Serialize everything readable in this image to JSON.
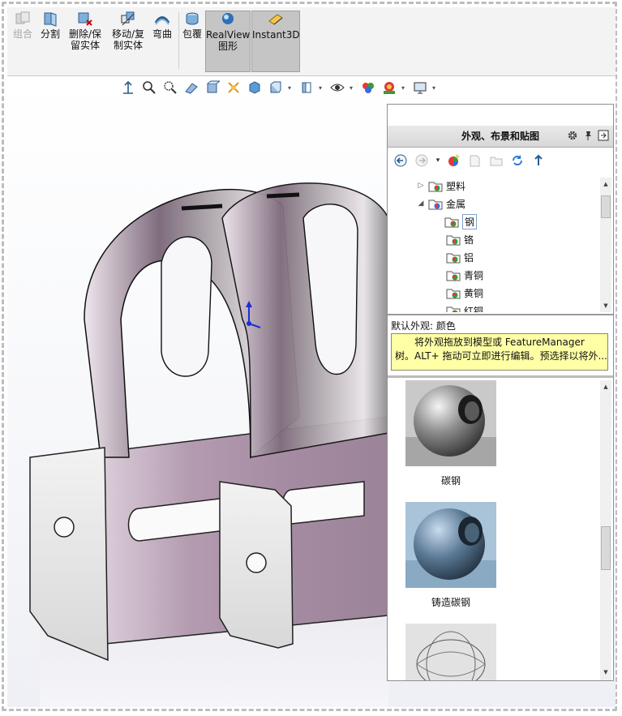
{
  "ribbon": {
    "buttons": [
      {
        "label1": "组合",
        "label2": "",
        "state": "disabled"
      },
      {
        "label1": "分割",
        "label2": "",
        "state": "normal"
      },
      {
        "label1": "删除/保",
        "label2": "留实体",
        "state": "normal"
      },
      {
        "label1": "移动/复",
        "label2": "制实体",
        "state": "normal"
      },
      {
        "label1": "弯曲",
        "label2": "",
        "state": "normal"
      },
      {
        "label1": "包覆",
        "label2": "",
        "state": "normal"
      },
      {
        "label1": "RealView",
        "label2": "图形",
        "state": "toggled"
      },
      {
        "label1": "Instant3D",
        "label2": "",
        "state": "toggled"
      }
    ]
  },
  "panel": {
    "title": "外观、布景和贴图",
    "tree": [
      {
        "label": "塑料",
        "twisty": "▷",
        "level": 1
      },
      {
        "label": "金属",
        "twisty": "◢",
        "level": 1
      },
      {
        "label": "钢",
        "twisty": "",
        "level": 2,
        "selected": true
      },
      {
        "label": "铬",
        "twisty": "",
        "level": 2
      },
      {
        "label": "铝",
        "twisty": "",
        "level": 2
      },
      {
        "label": "青铜",
        "twisty": "",
        "level": 2
      },
      {
        "label": "黄铜",
        "twisty": "",
        "level": 2
      },
      {
        "label": "红铜",
        "twisty": "",
        "level": 2
      }
    ],
    "default_appearance": "默认外观: 颜色",
    "tooltip_line1": "将外观拖放到模型或 FeatureManager",
    "tooltip_line2": "树。ALT+ 拖动可立即进行编辑。预选择以将外...",
    "gallery": [
      {
        "caption": "碳钢"
      },
      {
        "caption": "铸造碳钢"
      },
      {
        "caption": ""
      }
    ]
  },
  "colors": {
    "ribbon_bg": "#f3f3f3",
    "tooltip_bg": "#ffffa6",
    "part_tint": "#b49bb0",
    "toggle_bg": "#c5c5c5"
  }
}
